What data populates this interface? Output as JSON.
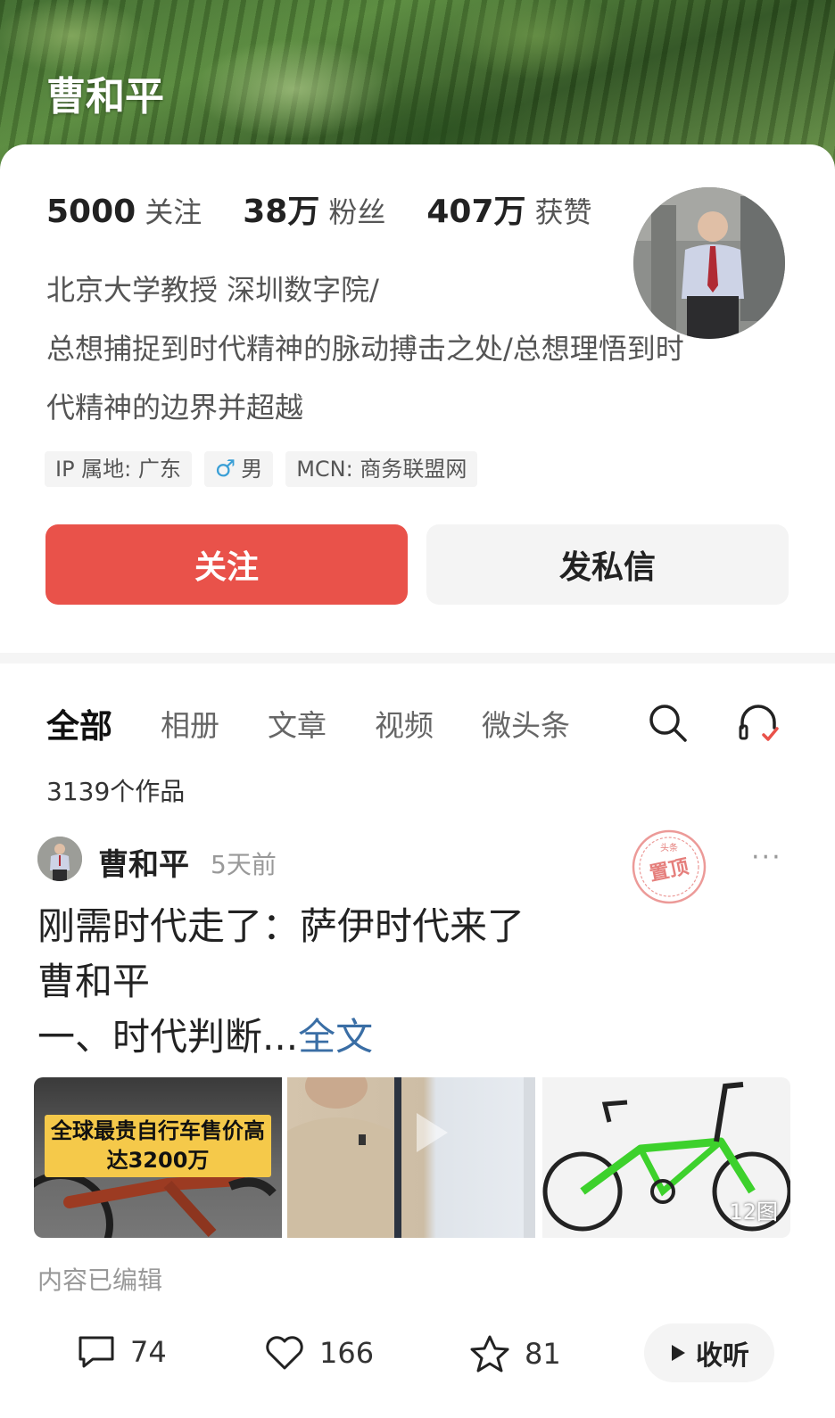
{
  "profile": {
    "name": "曹和平",
    "stats": [
      {
        "value": "5000",
        "label": "关注"
      },
      {
        "value": "38万",
        "label": "粉丝"
      },
      {
        "value": "407万",
        "label": "获赞"
      }
    ],
    "bio_lines": [
      "北京大学教授 深圳数字院/",
      "总想捕捉到时代精神的脉动搏击之处/总想理悟到时",
      "代精神的边界并超越"
    ],
    "tags": {
      "ip": "IP 属地: 广东",
      "gender": "男",
      "gender_icon": "♂",
      "mcn": "MCN: 商务联盟网"
    },
    "follow_button": "关注",
    "message_button": "发私信"
  },
  "tabs": [
    "全部",
    "相册",
    "文章",
    "视频",
    "微头条"
  ],
  "works_count": "3139个作品",
  "post": {
    "author": "曹和平",
    "time": "5天前",
    "pinned_label": "置顶",
    "pinned_top": "头条",
    "more": "···",
    "title_line1": "刚需时代走了：萨伊时代来了",
    "title_line2": "曹和平",
    "title_line3": "一、时代判断...",
    "full_text_link": "全文",
    "thumb1_banner_line1": "全球最贵自行车售价高",
    "thumb1_banner_line2": "达3200万",
    "image_count": "12图",
    "edited": "内容已编辑",
    "comments": "74",
    "likes": "166",
    "favorites": "81",
    "listen": "收听"
  },
  "colors": {
    "accent_red": "#e9524a",
    "link_blue": "#3a6ea5"
  }
}
